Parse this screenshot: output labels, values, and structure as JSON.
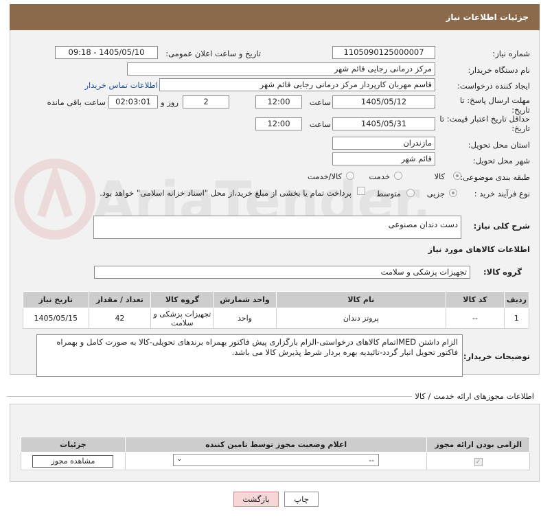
{
  "header": {
    "title": "جزئیات اطلاعات نیاز"
  },
  "fields": {
    "need_number_label": "شماره نیاز:",
    "need_number": "1105090125000007",
    "announce_label": "تاریخ و ساعت اعلان عمومی:",
    "announce_value": "1405/05/10 - 09:18",
    "buyer_org_label": "نام دستگاه خریدار:",
    "buyer_org": "مرکز درمانی رجایی قائم شهر",
    "creator_label": "ایجاد کننده درخواست:",
    "creator": "قاسم مهربان کارپرداز مرکز درمانی رجایی قائم شهر",
    "contact_link": "اطلاعات تماس خریدار",
    "deadline_label": "مهلت ارسال پاسخ: تا تاریخ:",
    "deadline_date": "1405/05/12",
    "time_word": "ساعت",
    "deadline_time": "12:00",
    "days_value": "2",
    "days_word": "روز و",
    "remaining_time": "02:03:01",
    "remaining_word": "ساعت باقی مانده",
    "price_valid_label": "حداقل تاریخ اعتبار قیمت: تا تاریخ:",
    "price_valid_date": "1405/05/31",
    "price_valid_time": "12:00",
    "province_label": "استان محل تحویل:",
    "province": "مازندران",
    "city_label": "شهر محل تحویل:",
    "city": "قائم شهر",
    "category_label": "طبقه بندی موضوعی:",
    "category_options": [
      "کالا",
      "خدمت",
      "کالا/خدمت"
    ],
    "process_label": "نوع فرآیند خرید :",
    "process_options": [
      "جزیی",
      "متوسط"
    ],
    "payment_note": "پرداخت تمام یا بخشی از مبلغ خرید،از محل \"اسناد خزانه اسلامی\" خواهد بود.",
    "desc_label": "شرح کلی نیاز:",
    "desc_value": "دست دندان مصنوعی",
    "goods_info_title": "اطلاعات کالاهای مورد نیاز",
    "goods_group_label": "گروه کالا:",
    "goods_group_value": "تجهیزات پزشکی و سلامت",
    "buyer_notes_label": "توضیحات خریدار:",
    "buyer_notes": "الزام داشتن IMEDتمام کالاهای درخواستی-الزام بارگزاری پیش فاکتور بهمراه برندهای تحویلی-کالا به صورت کامل و بهمراه فاکتور تحویل انبار گردد-تائیدیه بهره بردار شرط پذیرش کالا می باشد."
  },
  "goods_table": {
    "headers": [
      "ردیف",
      "کد کالا",
      "نام کالا",
      "واحد شمارش",
      "گروه کالا",
      "تعداد / مقدار",
      "تاریخ نیاز"
    ],
    "rows": [
      [
        "1",
        "--",
        "پروتز دندان",
        "واحد",
        "تجهیزات پزشکی و سلامت",
        "42",
        "1405/05/15"
      ]
    ]
  },
  "permits": {
    "title": "اطلاعات مجوزهای ارائه خدمت / کالا",
    "headers": [
      "الزامی بودن ارائه مجوز",
      "اعلام وضعیت مجوز توسط تامین کننده",
      "جزئیات"
    ],
    "select_value": "--",
    "view_button": "مشاهده مجوز"
  },
  "buttons": {
    "print": "چاپ",
    "back": "بازگشت"
  },
  "watermark_text": "AriaTender.net"
}
